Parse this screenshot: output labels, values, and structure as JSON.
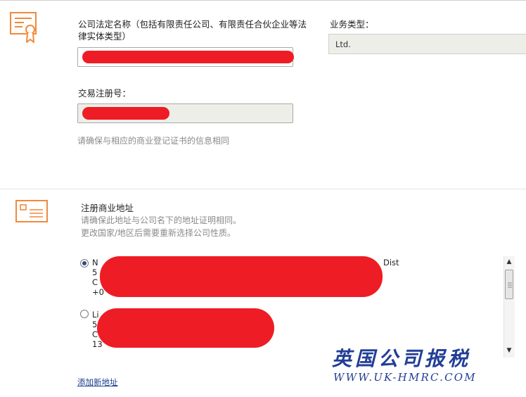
{
  "company": {
    "legal_name_label": "公司法定名称（包括有限责任公司、有限责任合伙企业等法律实体类型）",
    "business_type_label": "业务类型：",
    "business_type_value": "Ltd.",
    "registration_label": "交易注册号：",
    "registration_hint": "请确保与相应的商业登记证书的信息相同"
  },
  "address": {
    "title": "注册商业地址",
    "hint_line1": "请确保此地址与公司名下的地址证明相同。",
    "hint_line2": "更改国家/地区后需要重新选择公司性质。",
    "options": [
      {
        "line1": "N",
        "line1_suffix": "Dist",
        "line2": "5",
        "line3": "C",
        "line4": "+0",
        "selected": true
      },
      {
        "line1": "Li",
        "line2": "5",
        "line3": "C",
        "line4": "13",
        "selected": false
      }
    ],
    "add_link": "添加新地址"
  },
  "watermark": {
    "chinese": "英国公司报税",
    "url": "WWW.UK-HMRC.COM"
  },
  "colors": {
    "accent_icon": "#f08a3c",
    "redaction": "#ee1c25",
    "watermark": "#223e97"
  }
}
